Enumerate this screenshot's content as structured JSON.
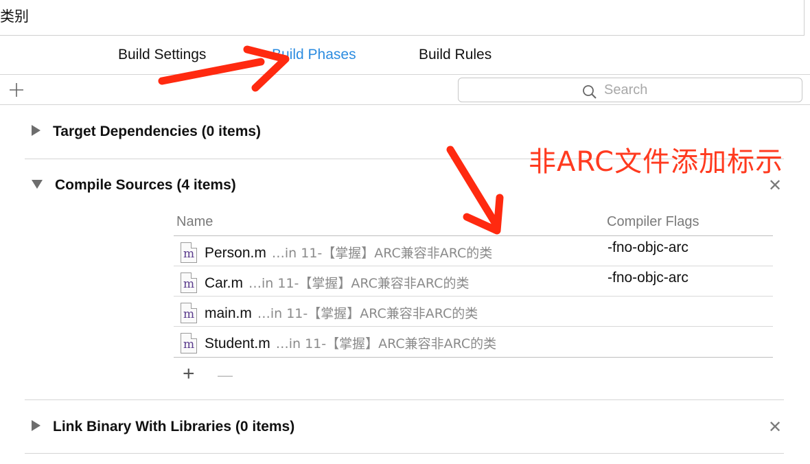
{
  "window": {
    "title_fragment": "类别"
  },
  "tabs": [
    {
      "label": "Build Settings",
      "active": false
    },
    {
      "label": "Build Phases",
      "active": true
    },
    {
      "label": "Build Rules",
      "active": false
    }
  ],
  "toolbar": {
    "add_icon": "plus-icon",
    "search_placeholder": "Search",
    "search_icon": "magnifier-icon"
  },
  "phases": {
    "target_dependencies": {
      "title": "Target Dependencies (0 items)",
      "expanded": false
    },
    "compile_sources": {
      "title": "Compile Sources (4 items)",
      "expanded": true,
      "columns": {
        "name": "Name",
        "flags": "Compiler Flags"
      },
      "files": [
        {
          "name": "Person.m",
          "path": "…in 11-【掌握】ARC兼容非ARC的类",
          "flags": "-fno-objc-arc"
        },
        {
          "name": "Car.m",
          "path": "…in 11-【掌握】ARC兼容非ARC的类",
          "flags": "-fno-objc-arc"
        },
        {
          "name": "main.m",
          "path": "…in 11-【掌握】ARC兼容非ARC的类",
          "flags": ""
        },
        {
          "name": "Student.m",
          "path": "…in 11-【掌握】ARC兼容非ARC的类",
          "flags": ""
        }
      ],
      "add_label": "+",
      "remove_label": "—"
    },
    "link_binary": {
      "title": "Link Binary With Libraries (0 items)",
      "expanded": false
    }
  },
  "annotation": {
    "text": "非ARC文件添加标示",
    "color": "#ff3a1f"
  },
  "colors": {
    "accent": "#2c8ce0",
    "annotation_red": "#ff3a1f"
  }
}
